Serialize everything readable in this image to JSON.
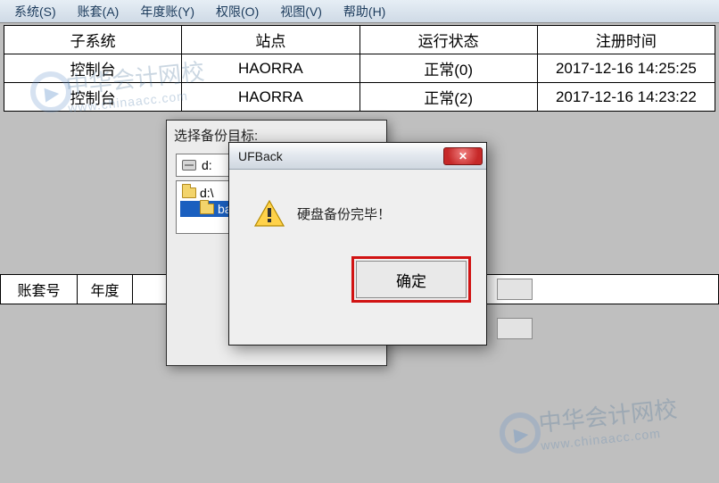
{
  "menu": {
    "system": "系统(S)",
    "ledger": "账套(A)",
    "yearly": "年度账(Y)",
    "perm": "权限(O)",
    "view": "视图(V)",
    "help": "帮助(H)"
  },
  "table": {
    "headers": {
      "subsystem": "子系统",
      "site": "站点",
      "status": "运行状态",
      "regtime": "注册时间"
    },
    "rows": [
      {
        "subsystem": "控制台",
        "site": "HAORRA",
        "status": "正常(0)",
        "regtime": "2017-12-16 14:25:25"
      },
      {
        "subsystem": "控制台",
        "site": "HAORRA",
        "status": "正常(2)",
        "regtime": "2017-12-16 14:23:22"
      }
    ]
  },
  "lower_headers": {
    "ledger_no": "账套号",
    "year": "年度"
  },
  "backup_dialog": {
    "title": "选择备份目标:",
    "drive": "d:",
    "tree_root": "d:\\",
    "tree_child": "backu"
  },
  "msg_dialog": {
    "title": "UFBack",
    "message": "硬盘备份完毕！",
    "ok": "确定"
  },
  "watermark": {
    "text": "中华会计网校",
    "url": "www.chinaacc.com"
  }
}
